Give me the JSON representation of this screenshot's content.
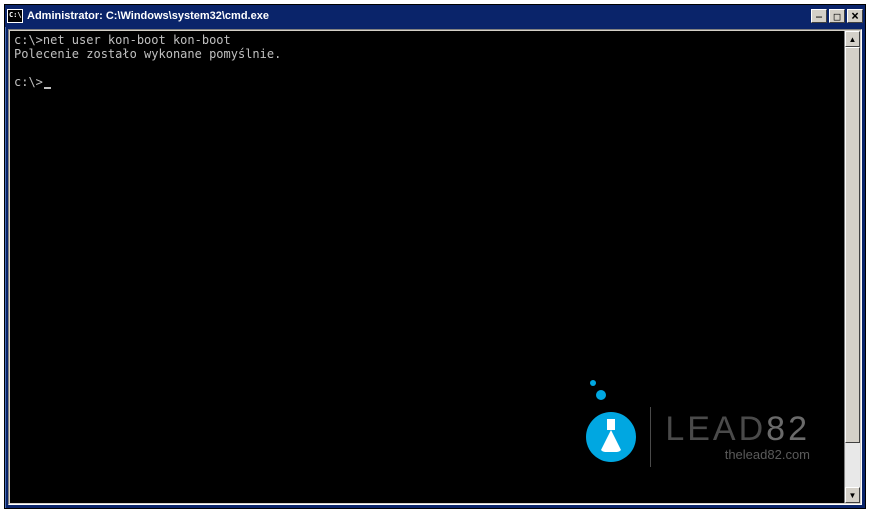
{
  "window": {
    "title": "Administrator: C:\\Windows\\system32\\cmd.exe"
  },
  "console": {
    "line1_prompt": "c:\\>",
    "line1_cmd": "net user kon-boot kon-boot",
    "line2": "Polecenie zostało wykonane pomyślnie.",
    "line3_blank": "",
    "line4_prompt": "c:\\>"
  },
  "watermark": {
    "brand_text": "LEAD",
    "brand_num": "82",
    "url": "thelead82.com"
  }
}
